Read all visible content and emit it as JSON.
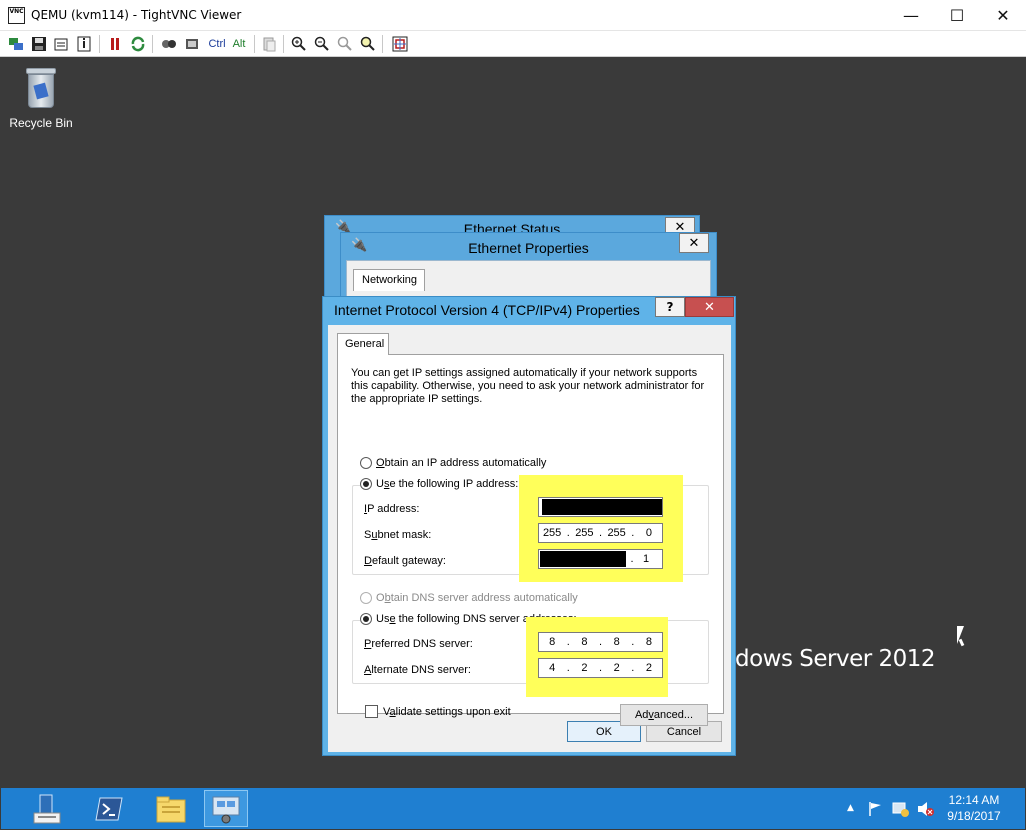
{
  "vnc": {
    "title": "QEMU (kvm114) - TightVNC Viewer",
    "app_icon_text": "VNC",
    "minimize": "—",
    "maximize": "☐",
    "close": "✕",
    "toolbar": {
      "ctrl_label": "Ctrl",
      "alt_label": "Alt"
    }
  },
  "desktop": {
    "recycle_bin_label": "Recycle Bin",
    "brand_text": "dows Server 2012"
  },
  "ethernet_status": {
    "title": "Ethernet Status",
    "close": "✕"
  },
  "ethernet_properties": {
    "title": "Ethernet Properties",
    "close": "✕",
    "tab_networking": "Networking"
  },
  "ipv4_dialog": {
    "title": "Internet Protocol Version 4 (TCP/IPv4) Properties",
    "help": "?",
    "close": "✕",
    "tab_general": "General",
    "description": "You can get IP settings assigned automatically if your network supports this capability. Otherwise, you need to ask your network administrator for the appropriate IP settings.",
    "obtain_ip_auto": {
      "pre": "",
      "key": "O",
      "post": "btain an IP address automatically"
    },
    "use_following_ip": {
      "pre": "U",
      "key": "s",
      "post": "e the following IP address:"
    },
    "ip_address_label": {
      "pre": "",
      "key": "I",
      "post": "P address:"
    },
    "subnet_label": {
      "pre": "S",
      "key": "u",
      "post": "bnet mask:"
    },
    "gateway_label": {
      "pre": "",
      "key": "D",
      "post": "efault gateway:"
    },
    "subnet_value": [
      "255",
      "255",
      "255",
      "0"
    ],
    "gateway_last_octet": "1",
    "obtain_dns_auto": {
      "pre": "O",
      "key": "b",
      "post": "tain DNS server address automatically"
    },
    "use_following_dns": {
      "pre": "Us",
      "key": "e",
      "post": " the following DNS server addresses:"
    },
    "preferred_dns_label": {
      "pre": "",
      "key": "P",
      "post": "referred DNS server:"
    },
    "alternate_dns_label": {
      "pre": "",
      "key": "A",
      "post": "lternate DNS server:"
    },
    "preferred_dns_value": [
      "8",
      "8",
      "8",
      "8"
    ],
    "alternate_dns_value": [
      "4",
      "2",
      "2",
      "2"
    ],
    "validate_label": {
      "pre": "V",
      "key": "a",
      "post": "lidate settings upon exit"
    },
    "advanced_button": {
      "pre": "Ad",
      "key": "v",
      "post": "anced..."
    },
    "ok_button": "OK",
    "cancel_button": "Cancel",
    "ip_dot": "."
  },
  "taskbar": {
    "clock_time": "12:14 AM",
    "clock_date": "9/18/2017",
    "tray_arrow": "▲"
  },
  "colors": {
    "highlight": "#ffff5a",
    "dialog_frame": "#5fb3e8",
    "taskbar": "#1f7fd1",
    "close_red": "#c75050"
  }
}
